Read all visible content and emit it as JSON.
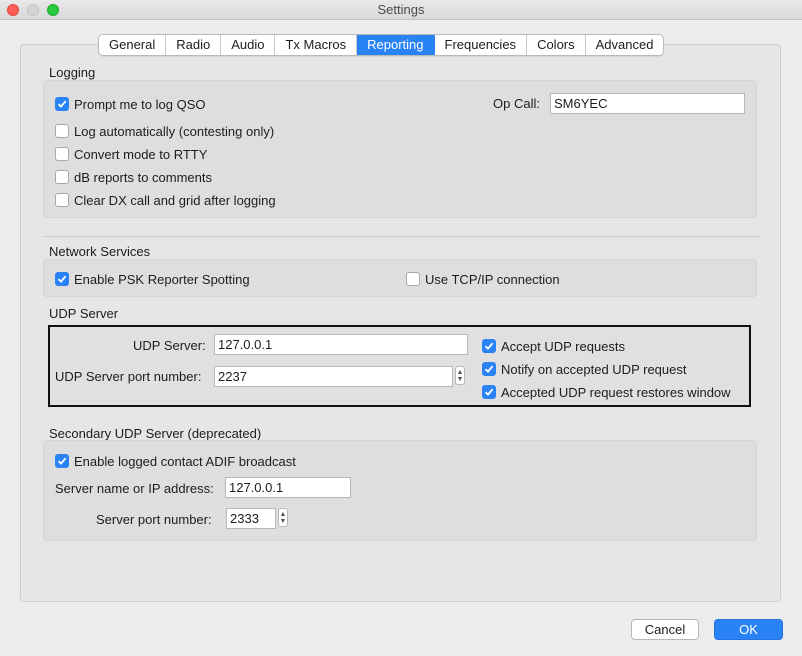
{
  "window": {
    "title": "Settings"
  },
  "tabs": [
    {
      "label": "General",
      "active": false
    },
    {
      "label": "Radio",
      "active": false
    },
    {
      "label": "Audio",
      "active": false
    },
    {
      "label": "Tx Macros",
      "active": false
    },
    {
      "label": "Reporting",
      "active": true
    },
    {
      "label": "Frequencies",
      "active": false
    },
    {
      "label": "Colors",
      "active": false
    },
    {
      "label": "Advanced",
      "active": false
    }
  ],
  "logging": {
    "title": "Logging",
    "prompt_log_qso": {
      "label": "Prompt me to log QSO",
      "checked": true
    },
    "log_automatically": {
      "label": "Log automatically (contesting only)",
      "checked": false
    },
    "convert_mode_rtty": {
      "label": "Convert mode to RTTY",
      "checked": false
    },
    "db_reports_comments": {
      "label": "dB reports to comments",
      "checked": false
    },
    "clear_dx_call": {
      "label": "Clear DX call and grid after logging",
      "checked": false
    },
    "op_call_label": "Op Call:",
    "op_call_value": "SM6YEC"
  },
  "network_services": {
    "title": "Network Services",
    "enable_psk_reporter": {
      "label": "Enable PSK Reporter Spotting",
      "checked": true
    },
    "use_tcpip": {
      "label": "Use TCP/IP connection",
      "checked": false
    }
  },
  "udp_server": {
    "title": "UDP Server",
    "server_label": "UDP Server:",
    "server_value": "127.0.0.1",
    "port_label": "UDP Server port number:",
    "port_value": "2237",
    "accept_requests": {
      "label": "Accept UDP requests",
      "checked": true
    },
    "notify_accepted": {
      "label": "Notify on accepted UDP request",
      "checked": true
    },
    "restores_window": {
      "label": "Accepted UDP request restores window",
      "checked": true
    }
  },
  "secondary_udp": {
    "title": "Secondary UDP Server (deprecated)",
    "enable_adif": {
      "label": "Enable logged contact ADIF broadcast",
      "checked": true
    },
    "server_label": "Server name or IP address:",
    "server_value": "127.0.0.1",
    "port_label": "Server port number:",
    "port_value": "2333"
  },
  "buttons": {
    "cancel": "Cancel",
    "ok": "OK"
  },
  "colors": {
    "accent": "#2a83f5"
  }
}
